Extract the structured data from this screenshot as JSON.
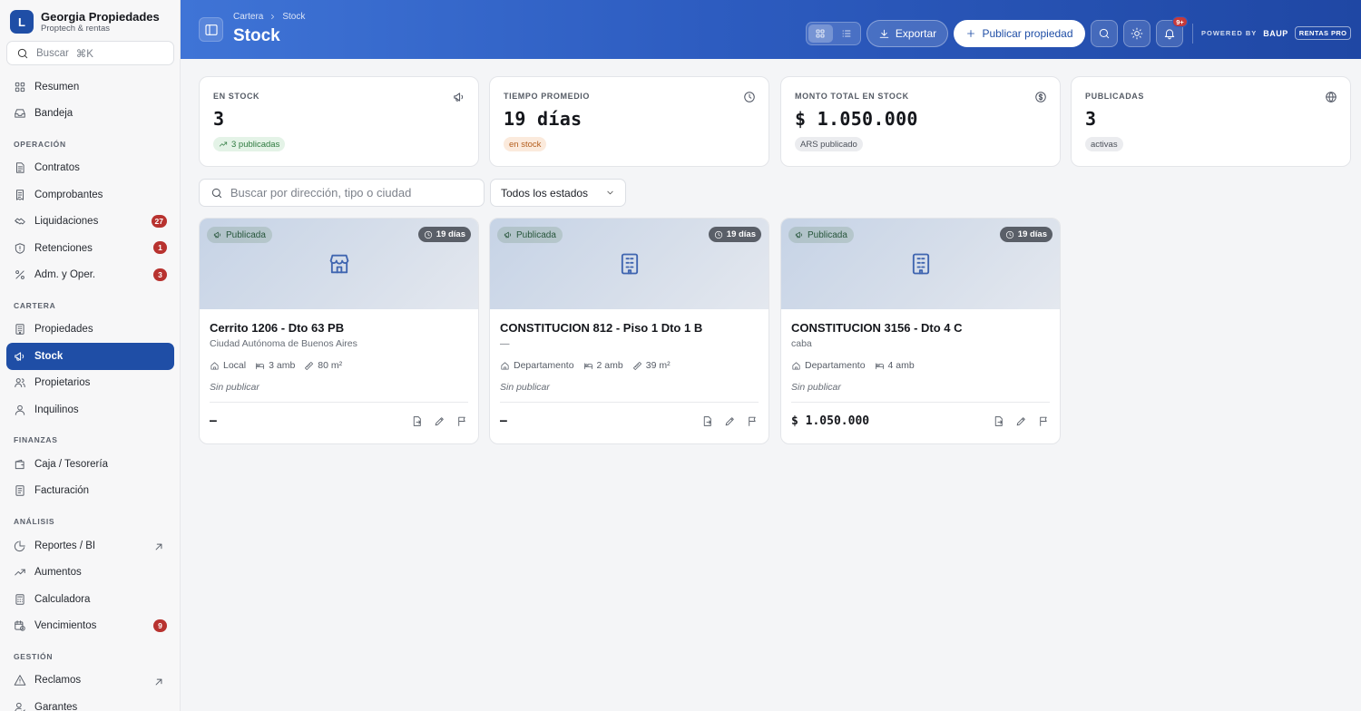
{
  "brand": {
    "logo_letter": "L",
    "name": "Georgia Propiedades",
    "subtitle": "Proptech & rentas"
  },
  "sidebar_search": {
    "placeholder": "Buscar",
    "shortcut": "⌘K"
  },
  "nav": {
    "top": [
      {
        "label": "Resumen",
        "icon": "grid-icon"
      },
      {
        "label": "Bandeja",
        "icon": "inbox-icon"
      }
    ],
    "sections": [
      {
        "title": "OPERACIÓN",
        "items": [
          {
            "label": "Contratos",
            "icon": "document-icon"
          },
          {
            "label": "Comprobantes",
            "icon": "receipt-icon"
          },
          {
            "label": "Liquidaciones",
            "icon": "handshake-icon",
            "badge": "27"
          },
          {
            "label": "Retenciones",
            "icon": "shield-icon",
            "badge": "1"
          },
          {
            "label": "Adm. y Oper.",
            "icon": "percent-icon",
            "badge": "3"
          }
        ]
      },
      {
        "title": "CARTERA",
        "items": [
          {
            "label": "Propiedades",
            "icon": "building-icon"
          },
          {
            "label": "Stock",
            "icon": "megaphone-icon",
            "active": true
          },
          {
            "label": "Propietarios",
            "icon": "users-icon"
          },
          {
            "label": "Inquilinos",
            "icon": "user-icon"
          }
        ]
      },
      {
        "title": "FINANZAS",
        "items": [
          {
            "label": "Caja / Tesorería",
            "icon": "wallet-icon"
          },
          {
            "label": "Facturación",
            "icon": "invoice-icon"
          }
        ]
      },
      {
        "title": "ANÁLISIS",
        "items": [
          {
            "label": "Reportes / BI",
            "icon": "pie-chart-icon",
            "external": true
          },
          {
            "label": "Aumentos",
            "icon": "trend-up-icon"
          },
          {
            "label": "Calculadora",
            "icon": "calculator-icon"
          },
          {
            "label": "Vencimientos",
            "icon": "calendar-clock-icon",
            "badge": "9"
          }
        ]
      },
      {
        "title": "GESTIÓN",
        "items": [
          {
            "label": "Reclamos",
            "icon": "warning-icon",
            "external": true
          },
          {
            "label": "Garantes",
            "icon": "user-check-icon"
          }
        ]
      }
    ]
  },
  "header": {
    "breadcrumb": [
      "Cartera",
      "Stock"
    ],
    "title": "Stock",
    "export_label": "Exportar",
    "publish_label": "Publicar propiedad",
    "notifications_badge": "9+",
    "powered_by": "POWERED BY",
    "powered_brand": "BAUP",
    "powered_tier": "RENTAS PRO"
  },
  "kpis": [
    {
      "label": "EN STOCK",
      "icon": "megaphone-icon",
      "value": "3",
      "pill": "3 publicadas",
      "pill_style": "green",
      "pill_icon": "trend-up-icon"
    },
    {
      "label": "TIEMPO PROMEDIO",
      "icon": "clock-icon",
      "value": "19 días",
      "pill": "en stock",
      "pill_style": "orange"
    },
    {
      "label": "MONTO TOTAL EN STOCK",
      "icon": "dollar-circle-icon",
      "value": "$ 1.050.000",
      "pill": "ARS publicado",
      "pill_style": "gray"
    },
    {
      "label": "PUBLICADAS",
      "icon": "globe-icon",
      "value": "3",
      "pill": "activas",
      "pill_style": "gray"
    }
  ],
  "filters": {
    "search_placeholder": "Buscar por dirección, tipo o ciudad",
    "state_select": "Todos los estados"
  },
  "properties": [
    {
      "status_tag": "Publicada",
      "days": "19 días",
      "type_icon": "store-icon",
      "title": "Cerrito 1206 - Dto 63 PB",
      "city": "Ciudad Autónoma de Buenos Aires",
      "type": "Local",
      "rooms": "3 amb",
      "area": "80 m²",
      "publish_state": "Sin publicar",
      "price": "–"
    },
    {
      "status_tag": "Publicada",
      "days": "19 días",
      "type_icon": "building-icon",
      "title": "CONSTITUCION 812 - Piso 1 Dto 1 B",
      "city": "—",
      "type": "Departamento",
      "rooms": "2 amb",
      "area": "39 m²",
      "publish_state": "Sin publicar",
      "price": "–"
    },
    {
      "status_tag": "Publicada",
      "days": "19 días",
      "type_icon": "building-icon",
      "title": "CONSTITUCION 3156 - Dto 4 C",
      "city": "caba",
      "type": "Departamento",
      "rooms": "4 amb",
      "area": "",
      "publish_state": "Sin publicar",
      "price": "$ 1.050.000"
    }
  ],
  "colors": {
    "accent": "#1f4ea6",
    "badge": "#b8322f",
    "header_start": "#3f74d6",
    "header_end": "#1f47a4"
  }
}
